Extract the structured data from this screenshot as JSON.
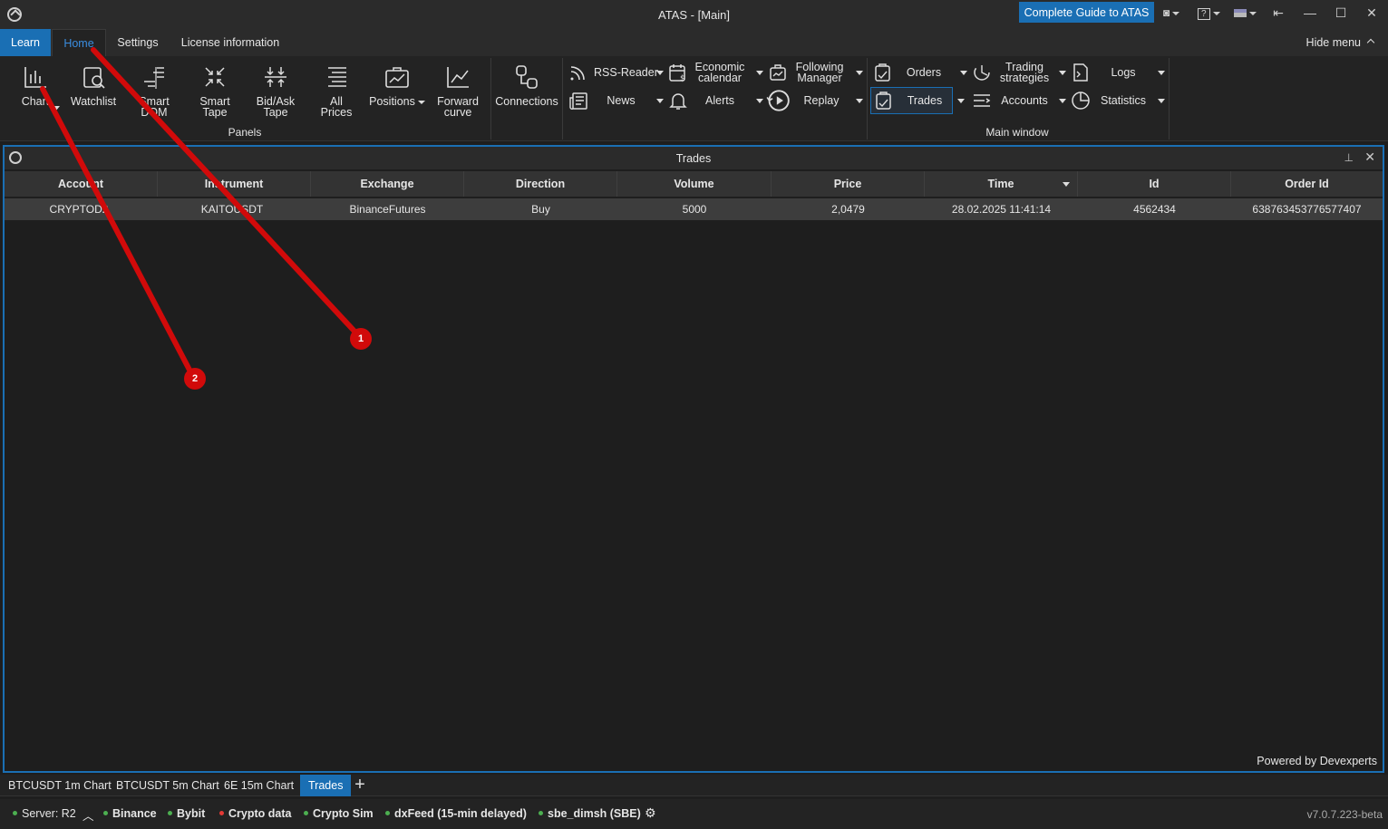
{
  "window": {
    "title": "ATAS - [Main]",
    "guide_button": "Complete Guide to ATAS"
  },
  "ribbon_tabs": [
    "Learn",
    "Home",
    "Settings",
    "License information"
  ],
  "hide_menu": "Hide menu",
  "panels_group": {
    "label": "Panels",
    "items": [
      "Chart",
      "Watchlist",
      "Smart DOM",
      "Smart Tape",
      "Bid/Ask Tape",
      "All Prices",
      "Positions",
      "Forward curve"
    ]
  },
  "connections": "Connections",
  "tools": {
    "rss": "RSS-Reader",
    "news": "News",
    "econ": "Economic calendar",
    "alerts": "Alerts",
    "following": "Following Manager",
    "replay": "Replay"
  },
  "main_window": {
    "label": "Main window",
    "orders": "Orders",
    "trades": "Trades",
    "strategies": "Trading strategies",
    "accounts": "Accounts",
    "logs": "Logs",
    "statistics": "Statistics"
  },
  "trades_panel": {
    "title": "Trades",
    "columns": [
      "Account",
      "Instrument",
      "Exchange",
      "Direction",
      "Volume",
      "Price",
      "Time",
      "Id",
      "Order Id"
    ],
    "rows": [
      [
        "CRYPTOD2",
        "KAITOUSDT",
        "BinanceFutures",
        "Buy",
        "5000",
        "2,0479",
        "28.02.2025 11:41:14",
        "4562434",
        "638763453776577407"
      ]
    ],
    "powered_by": "Powered by Devexperts"
  },
  "doc_tabs": [
    "BTCUSDT 1m Chart",
    "BTCUSDT 5m Chart",
    "6E 15m Chart",
    "Trades"
  ],
  "status": {
    "server": "Server: R2",
    "connections": [
      {
        "name": "Binance",
        "color": "#4caf50"
      },
      {
        "name": "Bybit",
        "color": "#4caf50"
      },
      {
        "name": "Crypto data",
        "color": "#e53935"
      },
      {
        "name": "Crypto Sim",
        "color": "#4caf50"
      },
      {
        "name": "dxFeed (15-min delayed)",
        "color": "#4caf50"
      },
      {
        "name": "sbe_dimsh (SBE)",
        "color": "#4caf50"
      }
    ],
    "version": "v7.0.7.223-beta"
  },
  "annotations": [
    {
      "label": "1"
    },
    {
      "label": "2"
    }
  ],
  "colors": {
    "accent": "#1a6fb4",
    "annotation": "#d10a0a"
  }
}
